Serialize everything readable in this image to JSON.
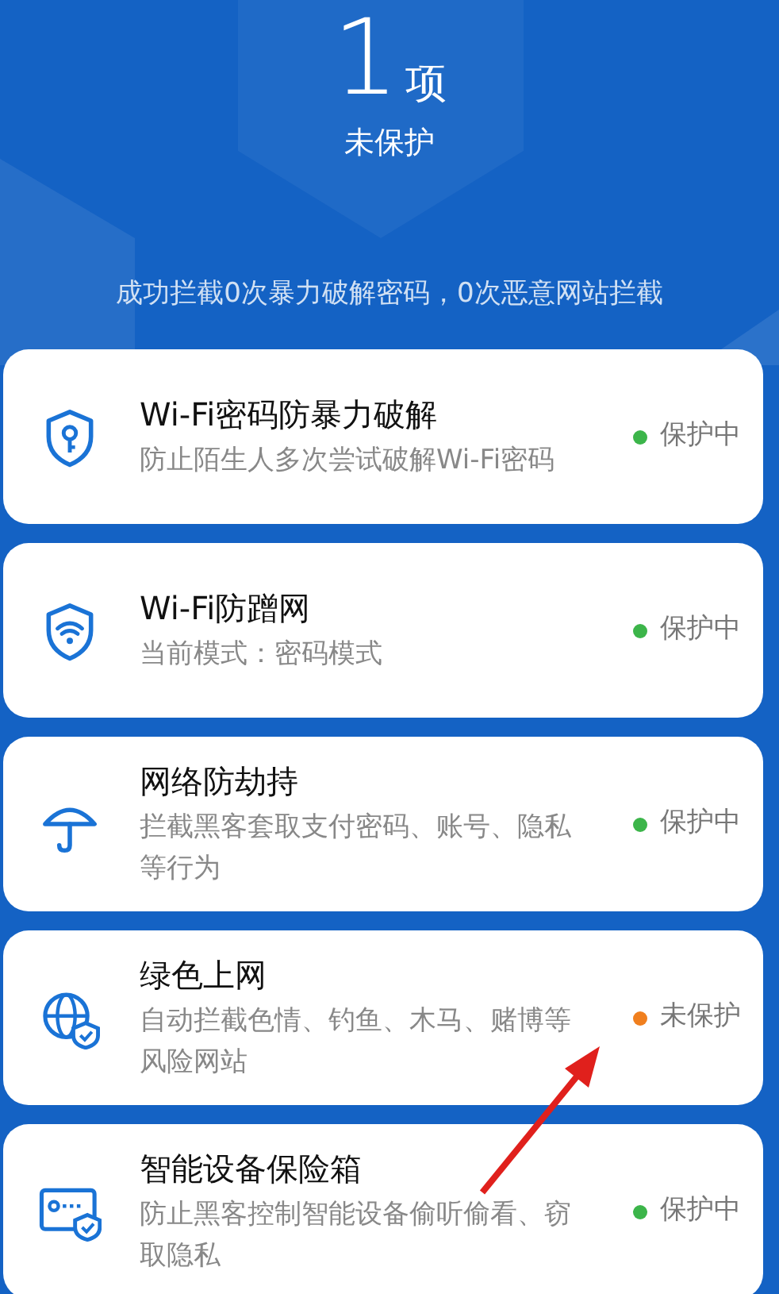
{
  "summary": {
    "count": "1",
    "unit": "项",
    "label": "未保护"
  },
  "stats": "成功拦截0次暴力破解密码，0次恶意网站拦截",
  "features": [
    {
      "title": "Wi-Fi密码防暴力破解",
      "description": "防止陌生人多次尝试破解Wi-Fi密码",
      "status": "保护中",
      "protected": true
    },
    {
      "title": "Wi-Fi防蹭网",
      "description": "当前模式：密码模式",
      "status": "保护中",
      "protected": true
    },
    {
      "title": "网络防劫持",
      "description": "拦截黑客套取支付密码、账号、隐私等行为",
      "status": "保护中",
      "protected": true
    },
    {
      "title": "绿色上网",
      "description": "自动拦截色情、钓鱼、木马、赌博等风险网站",
      "status": "未保护",
      "protected": false
    },
    {
      "title": "智能设备保险箱",
      "description": "防止黑客控制智能设备偷听偷看、窃取隐私",
      "status": "保护中",
      "protected": true
    }
  ]
}
